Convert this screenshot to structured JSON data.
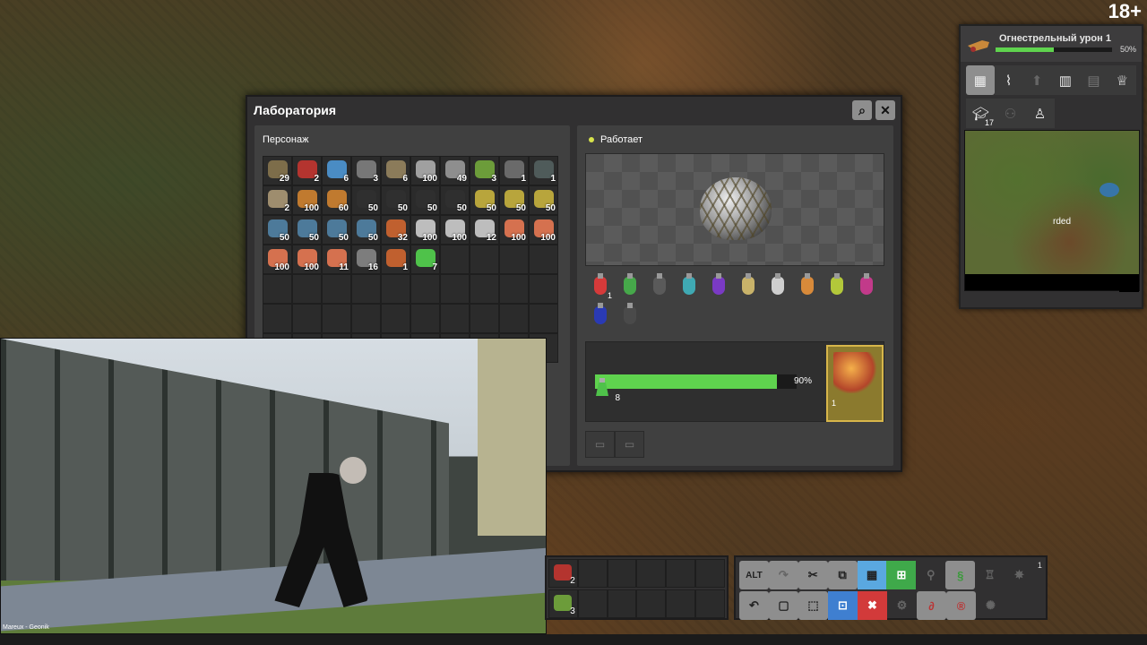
{
  "rating": "18+",
  "research": {
    "title": "Огнестрельный урон 1",
    "progress": 0.5,
    "progress_label": "50%",
    "queue_count": "17",
    "minimap_label": "rded"
  },
  "lab": {
    "title": "Лаборатория",
    "search_glyph": "⌕",
    "close_glyph": "✕",
    "inventory_caption": "Персонаж",
    "status": "Работает",
    "status_color": "#d7e34b",
    "inventory": [
      {
        "icon": "armor-icon",
        "color": "#7d6d4a",
        "count": "29"
      },
      {
        "icon": "red-gun-icon",
        "color": "#b4342f",
        "count": "2"
      },
      {
        "icon": "blue-gun-icon",
        "color": "#4a8cc4",
        "count": "6"
      },
      {
        "icon": "pipe-icon",
        "color": "#777",
        "count": "3"
      },
      {
        "icon": "stone-icon",
        "color": "#8b7b5a",
        "count": "6"
      },
      {
        "icon": "iron-plate-icon",
        "color": "#a0a0a0",
        "count": "100"
      },
      {
        "icon": "steel-plate-icon",
        "color": "#8e8e8e",
        "count": "49"
      },
      {
        "icon": "repair-pack-icon",
        "color": "#6c9c3a",
        "count": "3"
      },
      {
        "icon": "pickaxe-icon",
        "color": "#6a6a6a",
        "count": "1"
      },
      {
        "icon": "armor-suit-icon",
        "color": "#4f5b5a",
        "count": "1"
      },
      {
        "icon": "radar-icon",
        "color": "#9e8d6e",
        "count": "2"
      },
      {
        "icon": "copper-ore-icon",
        "color": "#c07a2f",
        "count": "100"
      },
      {
        "icon": "copper-ore-icon",
        "color": "#c07a2f",
        "count": "60"
      },
      {
        "icon": "coal-icon",
        "color": "#2f2f2f",
        "count": "50"
      },
      {
        "icon": "coal-icon",
        "color": "#2f2f2f",
        "count": "50"
      },
      {
        "icon": "coal-icon",
        "color": "#2f2f2f",
        "count": "50"
      },
      {
        "icon": "coal-icon",
        "color": "#2f2f2f",
        "count": "50"
      },
      {
        "icon": "sulfur-ore-icon",
        "color": "#b8a53c",
        "count": "50"
      },
      {
        "icon": "sulfur-ore-icon",
        "color": "#b8a53c",
        "count": "50"
      },
      {
        "icon": "sulfur-ore-icon",
        "color": "#b8a53c",
        "count": "50"
      },
      {
        "icon": "iron-ore-icon",
        "color": "#4d7a9a",
        "count": "50"
      },
      {
        "icon": "iron-ore-icon",
        "color": "#4d7a9a",
        "count": "50"
      },
      {
        "icon": "iron-ore-icon",
        "color": "#4d7a9a",
        "count": "50"
      },
      {
        "icon": "iron-ore-icon",
        "color": "#4d7a9a",
        "count": "50"
      },
      {
        "icon": "copper-cable-icon",
        "color": "#c0602f",
        "count": "32"
      },
      {
        "icon": "iron-plate-icon",
        "color": "#bdbdbd",
        "count": "100"
      },
      {
        "icon": "iron-plate-icon",
        "color": "#bdbdbd",
        "count": "100"
      },
      {
        "icon": "iron-plate-icon",
        "color": "#bdbdbd",
        "count": "12"
      },
      {
        "icon": "copper-plate-icon",
        "color": "#d5714f",
        "count": "100"
      },
      {
        "icon": "copper-plate-icon",
        "color": "#d5714f",
        "count": "100"
      },
      {
        "icon": "copper-plate-icon",
        "color": "#d5714f",
        "count": "100"
      },
      {
        "icon": "copper-plate-icon",
        "color": "#d5714f",
        "count": "100"
      },
      {
        "icon": "copper-plate-icon",
        "color": "#d5714f",
        "count": "11"
      },
      {
        "icon": "gear-icon",
        "color": "#7d7d7d",
        "count": "16"
      },
      {
        "icon": "copper-coil-icon",
        "color": "#c0602f",
        "count": "1"
      },
      {
        "icon": "green-flask-icon",
        "color": "#4fc24a",
        "count": "7"
      }
    ],
    "packs": [
      {
        "color": "#d63a3a",
        "count": "1"
      },
      {
        "color": "#46a84a",
        "count": ""
      },
      {
        "color": "#5a5a5a",
        "count": ""
      },
      {
        "color": "#3fa9b3",
        "count": ""
      },
      {
        "color": "#7a3ac4",
        "count": ""
      },
      {
        "color": "#c9b36a",
        "count": ""
      },
      {
        "color": "#cfcfcf",
        "count": ""
      },
      {
        "color": "#d88a3a",
        "count": ""
      },
      {
        "color": "#b3c83a",
        "count": ""
      },
      {
        "color": "#c23a8a",
        "count": ""
      },
      {
        "color": "#2a3ab4",
        "count": ""
      },
      {
        "color": "#4a4a4a",
        "count": ""
      }
    ],
    "progress": 0.9,
    "progress_label": "90%",
    "input_count": "8",
    "tech_level": "1"
  },
  "video": {
    "caption": "Mareux - Geonik"
  },
  "quickbar": {
    "slots": [
      {
        "icon": "red-gun-icon",
        "count": "2"
      },
      {
        "icon": "",
        "count": ""
      },
      {
        "icon": "",
        "count": ""
      },
      {
        "icon": "",
        "count": ""
      },
      {
        "icon": "",
        "count": ""
      },
      {
        "icon": "",
        "count": ""
      },
      {
        "icon": "repair-pack-icon",
        "count": "3"
      },
      {
        "icon": "",
        "count": ""
      },
      {
        "icon": "",
        "count": ""
      },
      {
        "icon": "",
        "count": ""
      },
      {
        "icon": "",
        "count": ""
      },
      {
        "icon": "",
        "count": ""
      }
    ]
  },
  "shortcuts": {
    "alt_label": "ALT",
    "page_num": "1"
  }
}
